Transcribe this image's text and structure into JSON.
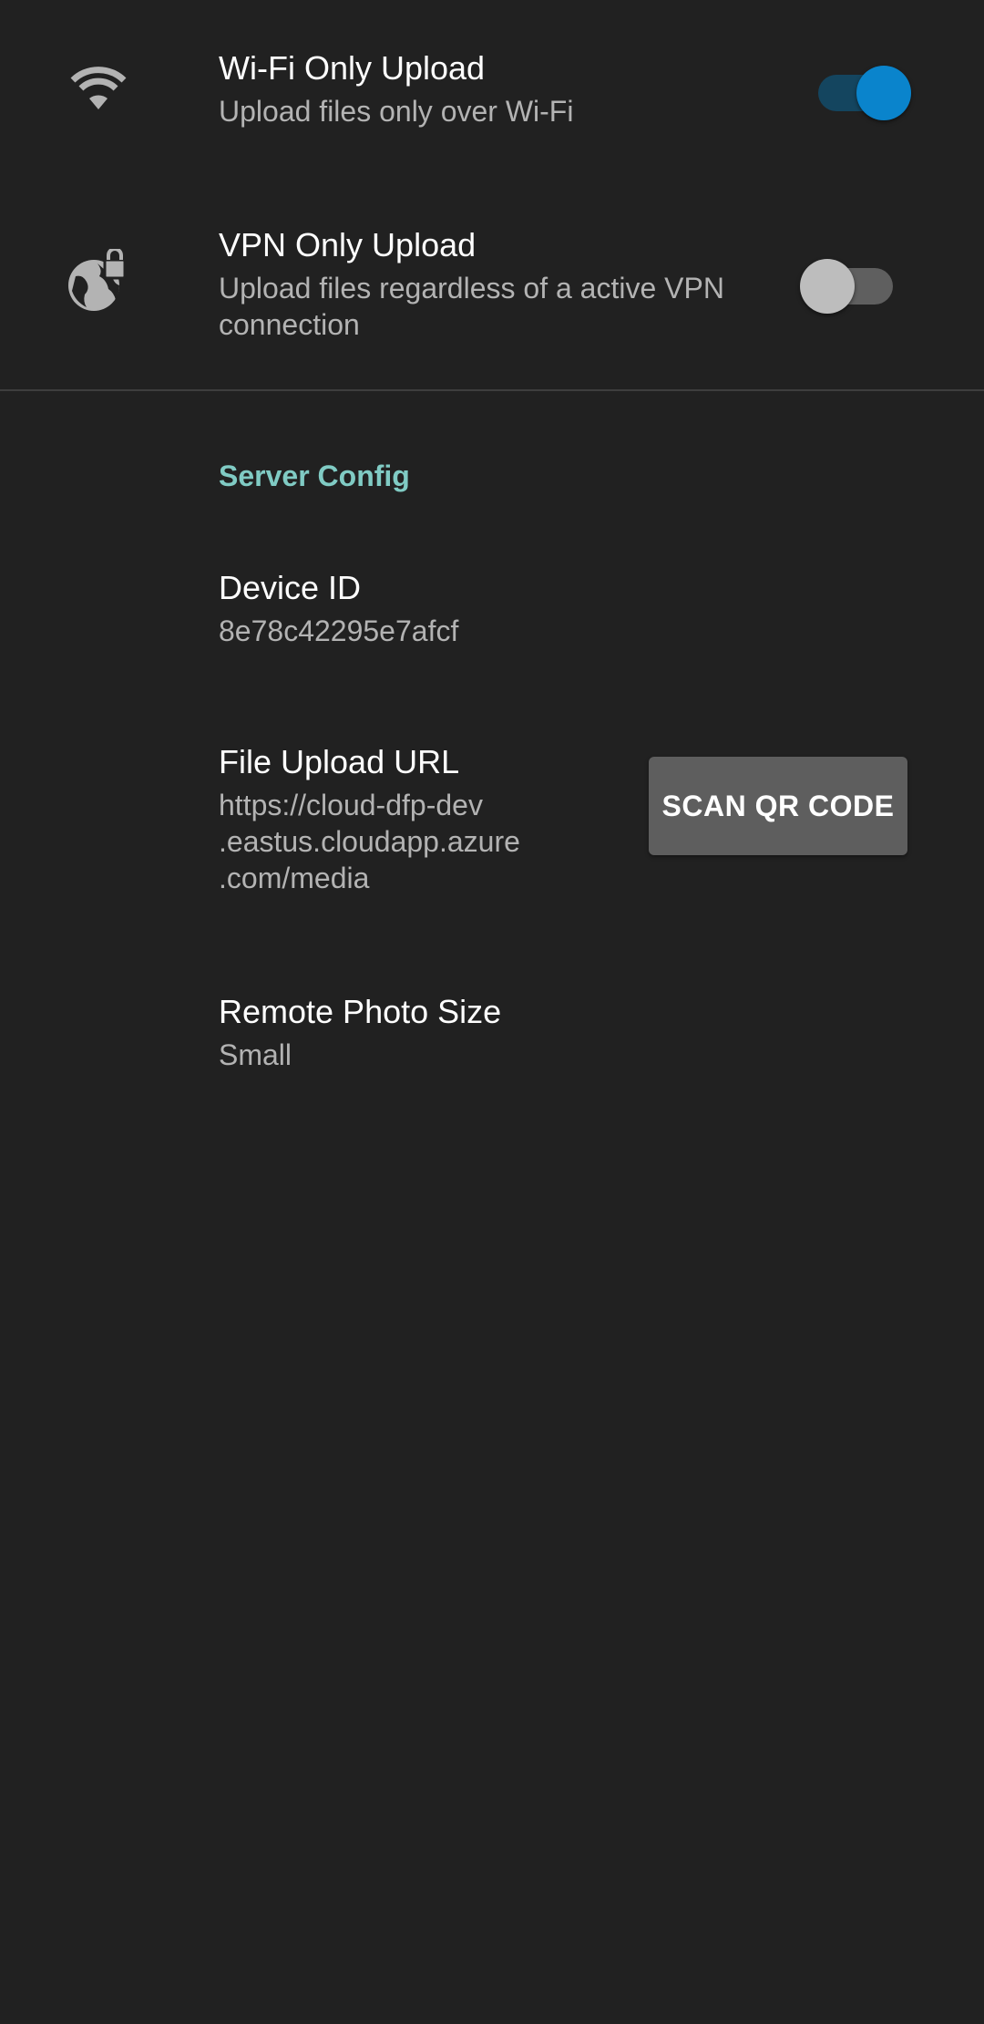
{
  "preferences": {
    "wifi_only": {
      "title": "Wi-Fi Only Upload",
      "summary": "Upload files only over Wi-Fi",
      "icon": "wifi-icon",
      "enabled": true
    },
    "vpn_only": {
      "title": "VPN Only Upload",
      "summary": "Upload files regardless of a active VPN connection",
      "icon": "vpn-lock-icon",
      "enabled": false
    }
  },
  "server_config": {
    "header": "Server Config",
    "device_id": {
      "title": "Device ID",
      "value": "8e78c42295e7afcf"
    },
    "file_upload_url": {
      "title": "File Upload URL",
      "value_lines": [
        "https://cloud-dfp-dev",
        ".eastus.cloudapp.azure",
        ".com/media"
      ],
      "button_label": "SCAN QR CODE"
    },
    "remote_photo_size": {
      "title": "Remote Photo Size",
      "value": "Small"
    }
  },
  "colors": {
    "background": "#212121",
    "accent": "#0a84cc",
    "section_header": "#80cbc4",
    "secondary_text": "#b3b3b3"
  }
}
